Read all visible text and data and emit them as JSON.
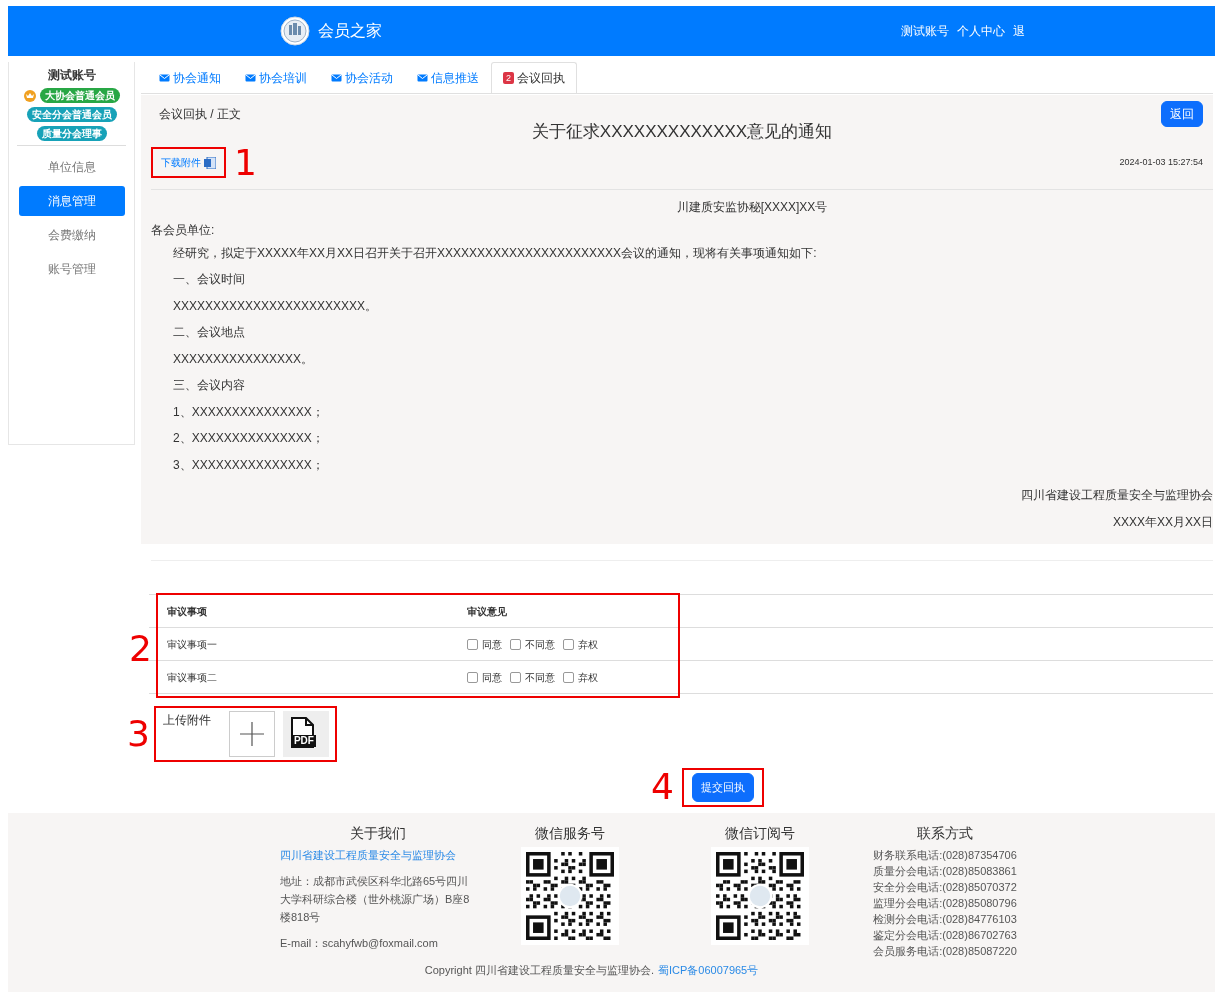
{
  "header": {
    "title": "会员之家",
    "links": [
      "测试账号",
      "个人中心",
      "退"
    ]
  },
  "sidebar": {
    "account": "测试账号",
    "badges": [
      {
        "text": "大协会普通会员",
        "color": "#28a745",
        "crown": true
      },
      {
        "text": "安全分会普通会员",
        "color": "#17a2b8",
        "crown": false
      },
      {
        "text": "质量分会理事",
        "color": "#17a2b8",
        "crown": false
      }
    ],
    "items": [
      {
        "label": "单位信息",
        "selected": false
      },
      {
        "label": "消息管理",
        "selected": true
      },
      {
        "label": "会费缴纳",
        "selected": false
      },
      {
        "label": "账号管理",
        "selected": false
      }
    ]
  },
  "tabs": [
    {
      "label": "协会通知",
      "selected": false,
      "kind": "mail"
    },
    {
      "label": "协会培训",
      "selected": false,
      "kind": "mail"
    },
    {
      "label": "协会活动",
      "selected": false,
      "kind": "mail"
    },
    {
      "label": "信息推送",
      "selected": false,
      "kind": "mail"
    },
    {
      "label": "会议回执",
      "selected": true,
      "kind": "count",
      "count": "2"
    }
  ],
  "notice": {
    "breadcrumb": "会议回执 / 正文",
    "back_button": "返回",
    "title": "关于征求XXXXXXXXXXXXX意见的通知",
    "download": {
      "label": "下载附件",
      "callout": "1"
    },
    "date": "2024-01-03 15:27:54",
    "doc_number": "川建质安监协秘[XXXX]XX号",
    "salutation": "各会员单位:",
    "paragraphs": [
      "经研究，拟定于XXXXX年XX月XX日召开关于召开XXXXXXXXXXXXXXXXXXXXXXX会议的通知，现将有关事项通知如下:",
      "一、会议时间",
      "XXXXXXXXXXXXXXXXXXXXXXXX。",
      "二、会议地点",
      "XXXXXXXXXXXXXXXX。",
      "三、会议内容",
      "1、XXXXXXXXXXXXXXX；",
      "2、XXXXXXXXXXXXXXX；",
      "3、XXXXXXXXXXXXXXX；"
    ],
    "signature": "四川省建设工程质量安全与监理协会",
    "signature_date": "XXXX年XX月XX日"
  },
  "vote_table": {
    "callout": "2",
    "columns": [
      "审议事项",
      "审议意见"
    ],
    "rows": [
      {
        "item": "审议事项一",
        "options": [
          {
            "label": "同意",
            "checked": false
          },
          {
            "label": "不同意",
            "checked": false
          },
          {
            "label": "弃权",
            "checked": false
          }
        ]
      },
      {
        "item": "审议事项二",
        "options": [
          {
            "label": "同意",
            "checked": false
          },
          {
            "label": "不同意",
            "checked": false
          },
          {
            "label": "弃权",
            "checked": false
          }
        ]
      }
    ]
  },
  "upload": {
    "callout": "3",
    "label": "上传附件",
    "files": [
      {
        "kind": "add"
      },
      {
        "kind": "pdf",
        "text": "PDF"
      }
    ]
  },
  "submit": {
    "callout": "4",
    "label": "提交回执"
  },
  "footer": {
    "about": {
      "title": "关于我们",
      "org_link": "四川省建设工程质量安全与监理协会",
      "address": "地址：成都市武侯区科华北路65号四川大学科研综合楼（世外桃源广场）B座8楼818号",
      "email": "E-mail：scahyfwb@foxmail.com"
    },
    "wechat": [
      {
        "title": "微信服务号"
      },
      {
        "title": "微信订阅号"
      }
    ],
    "contact": {
      "title": "联系方式",
      "lines": [
        "财务联系电话:(028)87354706",
        "质量分会电话:(028)85083861",
        "安全分会电话:(028)85070372",
        "监理分会电话:(028)85080796",
        "检测分会电话:(028)84776103",
        "鉴定分会电话:(028)86702763",
        "会员服务电话:(028)85087220"
      ]
    },
    "copyright": "Copyright 四川省建设工程质量安全与监理协会.",
    "icp_link": "蜀ICP备06007965号"
  }
}
